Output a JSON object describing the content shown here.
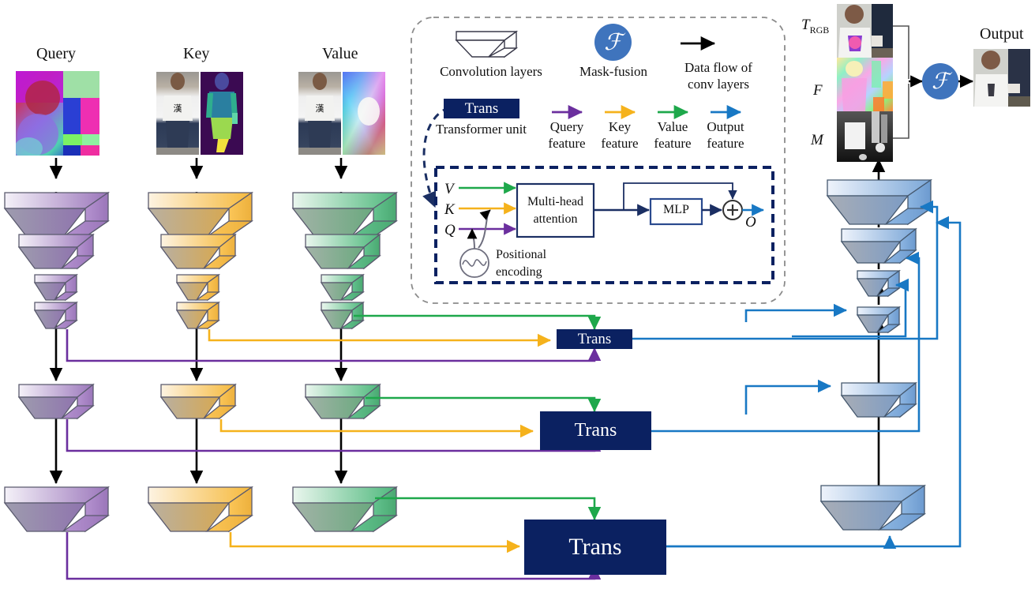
{
  "columns": {
    "query": {
      "title": "Query"
    },
    "key": {
      "title": "Key"
    },
    "value": {
      "title": "Value"
    }
  },
  "legend": {
    "conv_layers": "Convolution layers",
    "mask_fusion": "Mask-fusion",
    "mask_fusion_glyph": "ℱ",
    "data_flow_line1": "Data flow of",
    "data_flow_line2": "conv layers",
    "trans_label": "Trans",
    "transformer_unit": "Transformer unit",
    "arrows": [
      {
        "name": "query-feature",
        "line1": "Query",
        "line2": "feature",
        "color": "#6b2f9e"
      },
      {
        "name": "key-feature",
        "line1": "Key",
        "line2": "feature",
        "color": "#f5b21c"
      },
      {
        "name": "value-feature",
        "line1": "Value",
        "line2": "feature",
        "color": "#1ea84b"
      },
      {
        "name": "output-feature",
        "line1": "Output",
        "line2": "feature",
        "color": "#1878c4"
      }
    ]
  },
  "transformer_detail": {
    "v_label": "V",
    "k_label": "K",
    "q_label": "Q",
    "attention_line1": "Multi-head",
    "attention_line2": "attention",
    "mlp_label": "MLP",
    "output_label": "O",
    "plus_label": "+",
    "pos_enc_line1": "Positional",
    "pos_enc_line2": "encoding"
  },
  "outputs": {
    "t_rgb_main": "T",
    "t_rgb_sub": "RGB",
    "f_label": "F",
    "m_label": "M",
    "fusion_glyph": "ℱ",
    "output_title": "Output"
  },
  "trans_units": [
    {
      "name": "trans-stage-1",
      "label": "Trans"
    },
    {
      "name": "trans-stage-2",
      "label": "Trans"
    },
    {
      "name": "trans-stage-3",
      "label": "Trans"
    }
  ],
  "colors": {
    "query": "#8a63ad",
    "key": "#f2b33c",
    "value": "#3fae70",
    "output": "#1878c4",
    "trans_bg": "#0b2161",
    "fusion_blue": "#3f74bd",
    "data_flow": "#000000",
    "dashed_gray": "#8b8b8b"
  }
}
